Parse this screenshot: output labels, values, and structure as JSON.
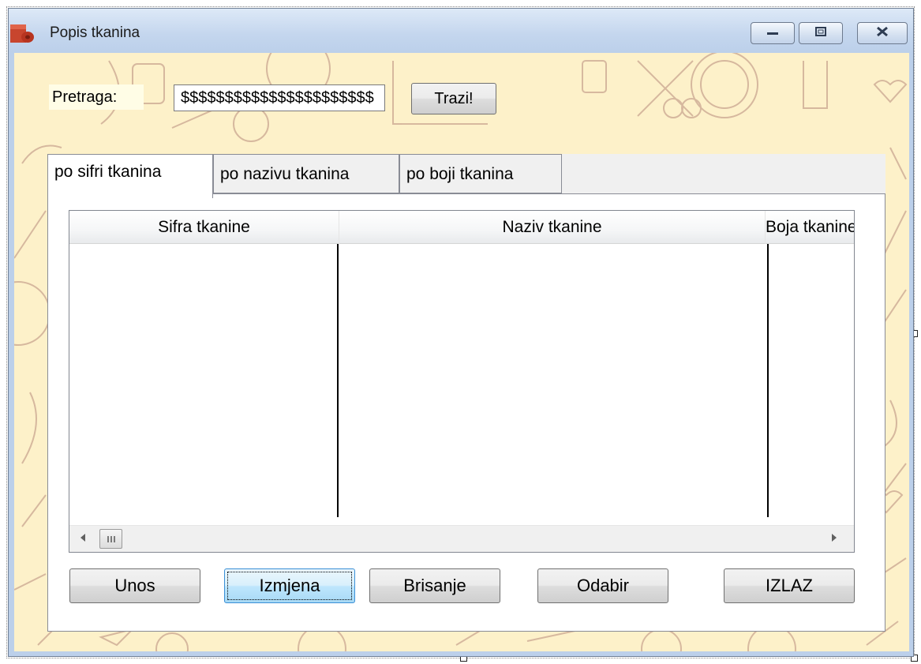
{
  "window": {
    "title": "Popis tkanina",
    "icon": "fabric-roll-icon",
    "controls": [
      "minimize-icon",
      "maximize-icon",
      "close-icon"
    ]
  },
  "search": {
    "label": "Pretraga:",
    "value": "$$$$$$$$$$$$$$$$$$$$$$",
    "button_label": "Trazi!"
  },
  "tabs": [
    {
      "label": "po sifri tkanina",
      "active": true
    },
    {
      "label": "po nazivu tkanina",
      "active": false
    },
    {
      "label": "po boji tkanina",
      "active": false
    }
  ],
  "grid": {
    "columns": [
      "Sifra tkanine",
      "Naziv tkanine",
      "Boja tkanine"
    ],
    "rows": []
  },
  "buttons": {
    "unos": "Unos",
    "izmjena": "Izmjena",
    "brisanje": "Brisanje",
    "odabir": "Odabir",
    "izlaz": "IZLAZ"
  },
  "colors": {
    "background": "#fdf1c9",
    "pattern": "#c9a590",
    "titlebar": "#bcd0ea"
  }
}
